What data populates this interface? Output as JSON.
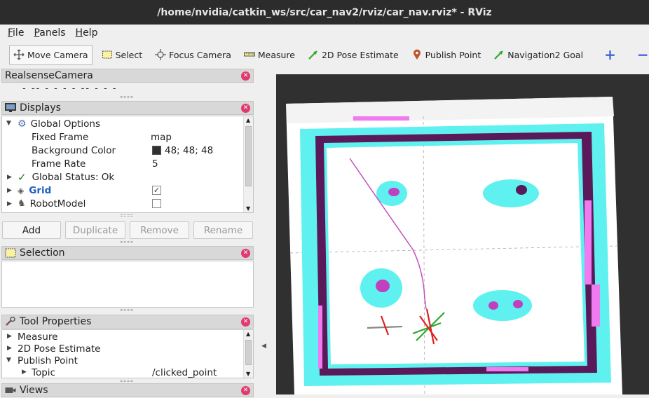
{
  "window": {
    "title": "/home/nvidia/catkin_ws/src/car_nav2/rviz/car_nav.rviz* - RViz"
  },
  "menu": {
    "items": [
      {
        "accel": "F",
        "rest": "ile"
      },
      {
        "accel": "P",
        "rest": "anels"
      },
      {
        "accel": "H",
        "rest": "elp"
      }
    ]
  },
  "toolbar": {
    "move_camera": "Move Camera",
    "select": "Select",
    "focus_camera": "Focus Camera",
    "measure": "Measure",
    "pose_estimate": "2D Pose Estimate",
    "publish_point": "Publish Point",
    "nav_goal": "Navigation2 Goal",
    "add_tool_icon": "plus-icon",
    "remove_tool_icon": "minus-icon"
  },
  "realsense_panel": {
    "title": "RealsenseCamera",
    "placeholder_dashes": "- -- - - - - -- - - -"
  },
  "displays_panel": {
    "title": "Displays",
    "global_options": "Global Options",
    "fixed_frame_label": "Fixed Frame",
    "fixed_frame_value": "map",
    "bg_color_label": "Background Color",
    "bg_color_value": "48; 48; 48",
    "bg_color_swatch": "#303030",
    "frame_rate_label": "Frame Rate",
    "frame_rate_value": "5",
    "global_status": "Global Status: Ok",
    "grid": "Grid",
    "robot_model": "RobotModel",
    "add": "Add",
    "duplicate": "Duplicate",
    "remove": "Remove",
    "rename": "Rename"
  },
  "selection_panel": {
    "title": "Selection"
  },
  "tool_properties_panel": {
    "title": "Tool Properties",
    "measure": "Measure",
    "pose_estimate": "2D Pose Estimate",
    "publish_point": "Publish Point",
    "topic_label": "Topic",
    "topic_value": "/clicked_point"
  },
  "views_panel": {
    "title": "Views"
  },
  "colors": {
    "title_bar": "#2c2c2c",
    "grid_link": "#1e5fc0",
    "close_button": "#e03a6e",
    "map_background": "#303030",
    "map_free": "#ffffff",
    "map_inflation": "#5ff0f0",
    "map_lethal": "#5a1a5a",
    "map_unknown_cost": "#f07af0"
  }
}
